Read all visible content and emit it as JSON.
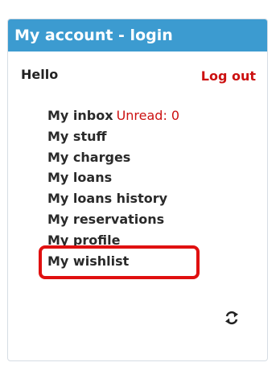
{
  "panel": {
    "title": "My account - login"
  },
  "greeting": {
    "hello": "Hello",
    "logout": "Log out"
  },
  "menu": {
    "inbox": "My inbox",
    "unread": "Unread: 0",
    "stuff": "My stuff",
    "charges": "My charges",
    "loans": "My loans",
    "loans_history": "My loans history",
    "reservations": "My reservations",
    "profile": "My profile",
    "wishlist": "My wishlist"
  },
  "icons": {
    "refresh": "refresh-icon"
  },
  "colors": {
    "header": "#3c9bd0",
    "logout": "#cc1111",
    "highlight": "#e01010"
  }
}
